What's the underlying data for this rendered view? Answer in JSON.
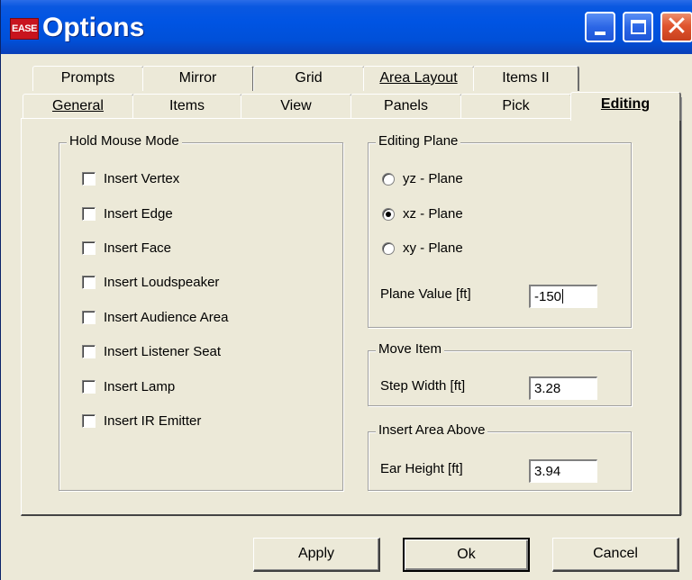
{
  "window": {
    "title": "Options",
    "logo_text": "EASE",
    "controls": {
      "close_symbol": "✕"
    }
  },
  "tabs_back": [
    "Prompts",
    "Mirror",
    "Grid",
    "Area Layout",
    "Items II"
  ],
  "tabs_front": [
    "General",
    "Items",
    "View",
    "Panels",
    "Pick",
    "Editing"
  ],
  "active_tab": "Editing",
  "hold_mouse_mode": {
    "title": "Hold Mouse Mode",
    "items": [
      {
        "label": "Insert Vertex",
        "checked": false
      },
      {
        "label": "Insert Edge",
        "checked": false
      },
      {
        "label": "Insert Face",
        "checked": false
      },
      {
        "label": "Insert Loudspeaker",
        "checked": false
      },
      {
        "label": "Insert Audience Area",
        "checked": false
      },
      {
        "label": "Insert Listener Seat",
        "checked": false
      },
      {
        "label": "Insert Lamp",
        "checked": false
      },
      {
        "label": "Insert IR Emitter",
        "checked": false
      }
    ]
  },
  "editing_plane": {
    "title": "Editing Plane",
    "options": [
      {
        "label": "yz - Plane",
        "selected": false
      },
      {
        "label": "xz - Plane",
        "selected": true
      },
      {
        "label": "xy - Plane",
        "selected": false
      }
    ],
    "plane_value_label": "Plane Value [ft]",
    "plane_value": "-150"
  },
  "move_item": {
    "title": "Move Item",
    "step_width_label": "Step Width [ft]",
    "step_width": "3.28"
  },
  "insert_area_above": {
    "title": "Insert Area Above",
    "ear_height_label": "Ear Height [ft]",
    "ear_height": "3.94"
  },
  "buttons": {
    "apply": "Apply",
    "ok": "Ok",
    "cancel": "Cancel"
  },
  "colors": {
    "titlebar": "#0054e3",
    "face": "#ece9d8",
    "close_button": "#e0552e"
  }
}
